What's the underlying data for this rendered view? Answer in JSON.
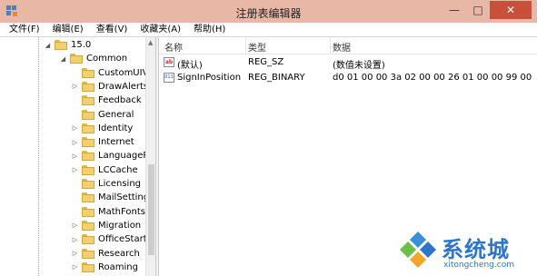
{
  "window": {
    "title": "注册表编辑器",
    "minimize_glyph": "—",
    "maximize_glyph": "□",
    "close_glyph": "✕"
  },
  "menu": [
    {
      "label": "文件(F)"
    },
    {
      "label": "编辑(E)"
    },
    {
      "label": "查看(V)"
    },
    {
      "label": "收藏夹(A)"
    },
    {
      "label": "帮助(H)"
    }
  ],
  "tree": [
    {
      "label": "15.0",
      "expander": "◢",
      "depth": 0
    },
    {
      "label": "Common",
      "expander": "◢",
      "depth": 1
    },
    {
      "label": "CustomUIVa",
      "expander": "",
      "depth": 2
    },
    {
      "label": "DrawAlerts",
      "expander": "▷",
      "depth": 2
    },
    {
      "label": "Feedback",
      "expander": "",
      "depth": 2
    },
    {
      "label": "General",
      "expander": "",
      "depth": 2
    },
    {
      "label": "Identity",
      "expander": "▷",
      "depth": 2
    },
    {
      "label": "Internet",
      "expander": "▷",
      "depth": 2
    },
    {
      "label": "LanguageRe",
      "expander": "▷",
      "depth": 2
    },
    {
      "label": "LCCache",
      "expander": "▷",
      "depth": 2
    },
    {
      "label": "Licensing",
      "expander": "",
      "depth": 2
    },
    {
      "label": "MailSettings",
      "expander": "",
      "depth": 2
    },
    {
      "label": "MathFonts",
      "expander": "",
      "depth": 2
    },
    {
      "label": "Migration",
      "expander": "▷",
      "depth": 2
    },
    {
      "label": "OfficeStart",
      "expander": "▷",
      "depth": 2
    },
    {
      "label": "Research",
      "expander": "▷",
      "depth": 2
    },
    {
      "label": "Roaming",
      "expander": "▷",
      "depth": 2
    }
  ],
  "list": {
    "headers": {
      "name": "名称",
      "type": "类型",
      "data": "数据"
    },
    "rows": [
      {
        "icon": "string-value-icon",
        "icon_text": "ab",
        "name": "(默认)",
        "type": "REG_SZ",
        "data": "(数值未设置)"
      },
      {
        "icon": "binary-value-icon",
        "icon_text": "011",
        "name": "SignInPosition",
        "type": "REG_BINARY",
        "data": "d0 01 00 00 3a 02 00 00 26 01 00 00 99 00 00..."
      }
    ]
  },
  "watermark": {
    "brand": "系统城",
    "url": "xitongcheng.com"
  },
  "colors": {
    "titlebar": "#e8b7a6",
    "close_button": "#c7503a",
    "folder": "#f3d06f",
    "watermark": "#2e75c8"
  }
}
